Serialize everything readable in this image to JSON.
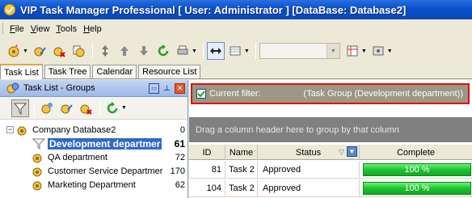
{
  "window": {
    "title": "VIP Task Manager Professional [ User: Administrator ] [DataBase: Database2]"
  },
  "menu": [
    {
      "label": "File",
      "key": "F",
      "rest": "ile"
    },
    {
      "label": "View",
      "key": "V",
      "rest": "iew"
    },
    {
      "label": "Tools",
      "key": "T",
      "rest": "ools"
    },
    {
      "label": "Help",
      "key": "H",
      "rest": "elp"
    }
  ],
  "tabs": [
    "Task List",
    "Task Tree",
    "Calendar",
    "Resource List"
  ],
  "left_panel": {
    "title": "Task List - Groups",
    "tree": [
      {
        "label": "Company Database2",
        "count": "0"
      },
      {
        "label": "Development departmer",
        "count": "61"
      },
      {
        "label": "QA department",
        "count": "72"
      },
      {
        "label": "Customer Service Departmer",
        "count": "170"
      },
      {
        "label": "Marketing Department",
        "count": "62"
      }
    ]
  },
  "filter": {
    "label": "Current filter:",
    "value": "(Task Group  (Development department))"
  },
  "group_panel": {
    "hint": "Drag a column header here to group by that column"
  },
  "grid": {
    "columns": [
      "ID",
      "Name",
      "Status",
      "Complete"
    ],
    "rows": [
      {
        "id": "81",
        "name": "Task 2",
        "status": "Approved",
        "complete": "100 %",
        "complete_fraction": 1.0
      },
      {
        "id": "104",
        "name": "Task 2",
        "status": "Approved",
        "complete": "100 %",
        "complete_fraction": 1.0
      }
    ]
  },
  "colors": {
    "titlebar": "#0a4fc9",
    "selection": "#316ac5",
    "filter_highlight": "#e01010",
    "progress": "#1dc32f",
    "tab_accent": "#e8a33d"
  }
}
